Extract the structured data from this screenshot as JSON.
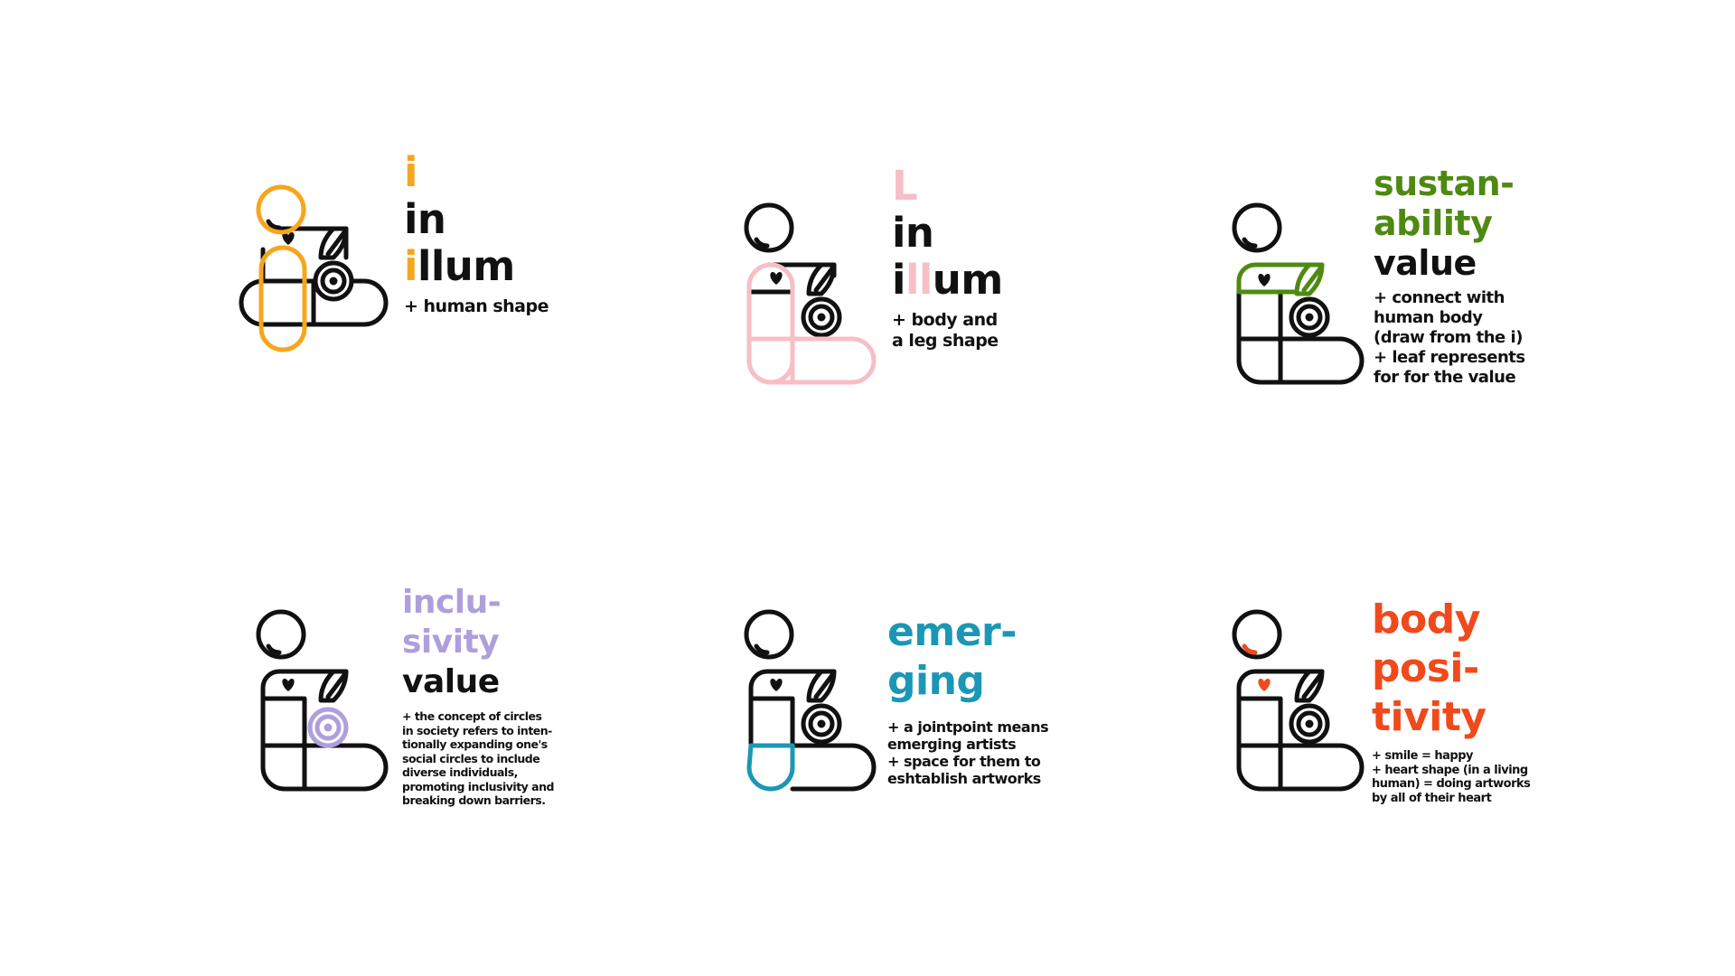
{
  "colors": {
    "ink": "#111111",
    "orange": "#f6a61d",
    "pink": "#f7bec6",
    "green": "#4e8a12",
    "lavender": "#ae9fdc",
    "teal": "#1b97b5",
    "red": "#f0491c"
  },
  "panels": [
    {
      "id": "human-shape",
      "highlight": "head-and-body",
      "accent": "#f6a61d",
      "line1": {
        "a": "i",
        "b": ""
      },
      "line2": "in",
      "line3": {
        "a": "i",
        "b": "llum"
      },
      "note": "+ human shape"
    },
    {
      "id": "body-and-leg",
      "highlight": "body-and-leg",
      "accent": "#f7bec6",
      "line1": "L",
      "line2": "in",
      "line3": {
        "a": "i",
        "b": "ll",
        "c": "um"
      },
      "note": "+ body and\na leg shape"
    },
    {
      "id": "sustainability",
      "highlight": "leaf-band",
      "accent": "#4e8a12",
      "line1": "sustan-",
      "line2": "ability",
      "line3": "value",
      "note": "+ connect with\nhuman body\n(draw from the i)\n+ leaf represents\nfor for the value"
    },
    {
      "id": "inclusivity",
      "highlight": "circles",
      "accent": "#ae9fdc",
      "line1": "inclu-",
      "line2": "sivity",
      "line3": "value",
      "note": "+ the concept of circles\nin society refers to inten-\ntionally expanding one's\nsocial circles to include\ndiverse individuals,\npromoting inclusivity and\nbreaking down barriers."
    },
    {
      "id": "emerging",
      "highlight": "joint",
      "accent": "#1b97b5",
      "line1": "emer-",
      "line2": "ging",
      "note": "+ a jointpoint means\nemerging artists\n+ space for them to\neshtablish artworks"
    },
    {
      "id": "body-positivity",
      "highlight": "smile-heart",
      "accent": "#f0491c",
      "line1": "body",
      "line2": "posi-",
      "line3": "tivity",
      "note": "+ smile = happy\n+ heart shape (in a living\nhuman) = doing artworks\nby all of their heart"
    }
  ]
}
